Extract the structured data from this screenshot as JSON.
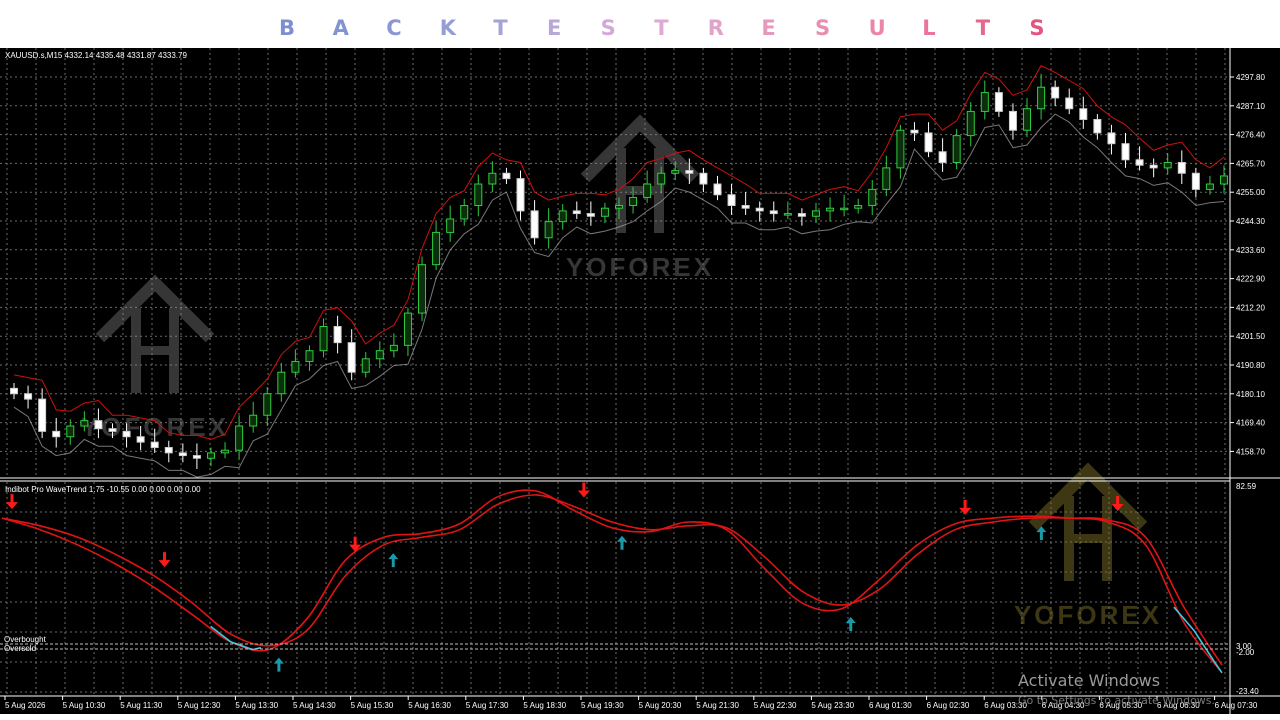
{
  "banner": {
    "letters": [
      {
        "char": "B",
        "color": "#7d8fd0"
      },
      {
        "char": "A",
        "color": "#8293d2"
      },
      {
        "char": "C",
        "color": "#8a97d4"
      },
      {
        "char": "K",
        "color": "#949dd6"
      },
      {
        "char": "T",
        "color": "#a3a3d8"
      },
      {
        "char": "E",
        "color": "#b8a8d8"
      },
      {
        "char": "S",
        "color": "#d3a9d8"
      },
      {
        "char": "T",
        "color": "#e0a8d4"
      },
      {
        "char": "R",
        "color": "#e2a3c8"
      },
      {
        "char": "E",
        "color": "#e59abd"
      },
      {
        "char": "S",
        "color": "#e88eb0"
      },
      {
        "char": "U",
        "color": "#ea86a6"
      },
      {
        "char": "L",
        "color": "#e9769a"
      },
      {
        "char": "T",
        "color": "#e6668c"
      },
      {
        "char": "S",
        "color": "#e2557e"
      }
    ]
  },
  "main_chart": {
    "info": "XAUUSD.s,M15  4332.14 4335.48 4331.87 4333.79",
    "price_ticks": [
      "4297.80",
      "4287.10",
      "4276.40",
      "4265.70",
      "4255.00",
      "4244.30",
      "4233.60",
      "4222.90",
      "4212.20",
      "4201.50",
      "4190.80",
      "4180.10",
      "4169.40",
      "4158.70"
    ]
  },
  "indicator": {
    "info": "Indibot Pro WaveTrend 1.75 -10.55 0.00 0.00 0.00 0.00",
    "axis_ticks": [
      "82.59",
      "3.00",
      "-2.00",
      "-23.40"
    ],
    "overbought_label": "Overbought",
    "oversold_label": "Oversold"
  },
  "time_axis": [
    "5 Aug 2026",
    "5 Aug 10:30",
    "5 Aug 11:30",
    "5 Aug 12:30",
    "5 Aug 13:30",
    "5 Aug 14:30",
    "5 Aug 15:30",
    "5 Aug 16:30",
    "5 Aug 17:30",
    "5 Aug 18:30",
    "5 Aug 19:30",
    "5 Aug 20:30",
    "5 Aug 21:30",
    "5 Aug 22:30",
    "5 Aug 23:30",
    "6 Aug 01:30",
    "6 Aug 02:30",
    "6 Aug 03:30",
    "6 Aug 04:30",
    "6 Aug 05:30",
    "6 Aug 06:30",
    "6 Aug 07:30"
  ],
  "watermark": {
    "text": "YOFOREX"
  },
  "os_notice": {
    "title": "Activate Windows",
    "subtitle": "Go to Settings to activate Windows."
  },
  "colors": {
    "bull_candle": "#0a2f0a",
    "bull_border": "#2ecc40",
    "bear_candle": "#ffffff",
    "envelope": "#d01010",
    "wavetrend": "#e01414",
    "wavetrend_low": "#40c8e0",
    "arrow_sell": "#ff1a1a",
    "arrow_buy": "#1a9aa8",
    "grid": "#6b6b6b"
  },
  "chart_data": {
    "type": "candlestick",
    "symbol": "XAUUSD.s",
    "timeframe": "M15",
    "ylim": [
      4150,
      4305
    ],
    "close_path": [
      4180,
      4178,
      4166,
      4164,
      4168,
      4170,
      4167,
      4166,
      4164,
      4162,
      4160,
      4158,
      4157,
      4156,
      4158,
      4159,
      4168,
      4172,
      4180,
      4188,
      4192,
      4196,
      4205,
      4199,
      4188,
      4193,
      4196,
      4198,
      4210,
      4228,
      4240,
      4245,
      4250,
      4258,
      4262,
      4260,
      4248,
      4238,
      4244,
      4248,
      4247,
      4246,
      4249,
      4250,
      4253,
      4258,
      4262,
      4263,
      4262,
      4258,
      4254,
      4250,
      4249,
      4248,
      4247,
      4247,
      4246,
      4248,
      4249,
      4249,
      4250,
      4256,
      4264,
      4278,
      4277,
      4270,
      4266,
      4276,
      4285,
      4292,
      4285,
      4278,
      4286,
      4294,
      4290,
      4286,
      4282,
      4277,
      4273,
      4267,
      4265,
      4264,
      4266,
      4262,
      4256,
      4258,
      4261
    ],
    "wavetrend": {
      "range": [
        -23.4,
        82.59
      ],
      "overbought": 3.0,
      "oversold": -2.0,
      "wt1": [
        66,
        60,
        52,
        42,
        30,
        16,
        2,
        -2,
        14,
        44,
        56,
        58,
        63,
        77,
        80,
        70,
        61,
        59,
        64,
        60,
        40,
        22,
        19,
        34,
        52,
        63,
        66,
        67,
        66,
        64,
        52,
        12,
        -14
      ],
      "wt2": [
        66,
        62,
        56,
        47,
        36,
        22,
        6,
        0,
        8,
        36,
        52,
        56,
        60,
        73,
        78,
        72,
        64,
        60,
        62,
        61,
        46,
        28,
        21,
        29,
        47,
        60,
        64,
        66,
        66,
        65,
        56,
        20,
        -10
      ],
      "sell_signals": [
        0,
        4,
        9,
        15,
        25,
        29
      ],
      "buy_signals": [
        7,
        10,
        16,
        22,
        27
      ]
    }
  }
}
